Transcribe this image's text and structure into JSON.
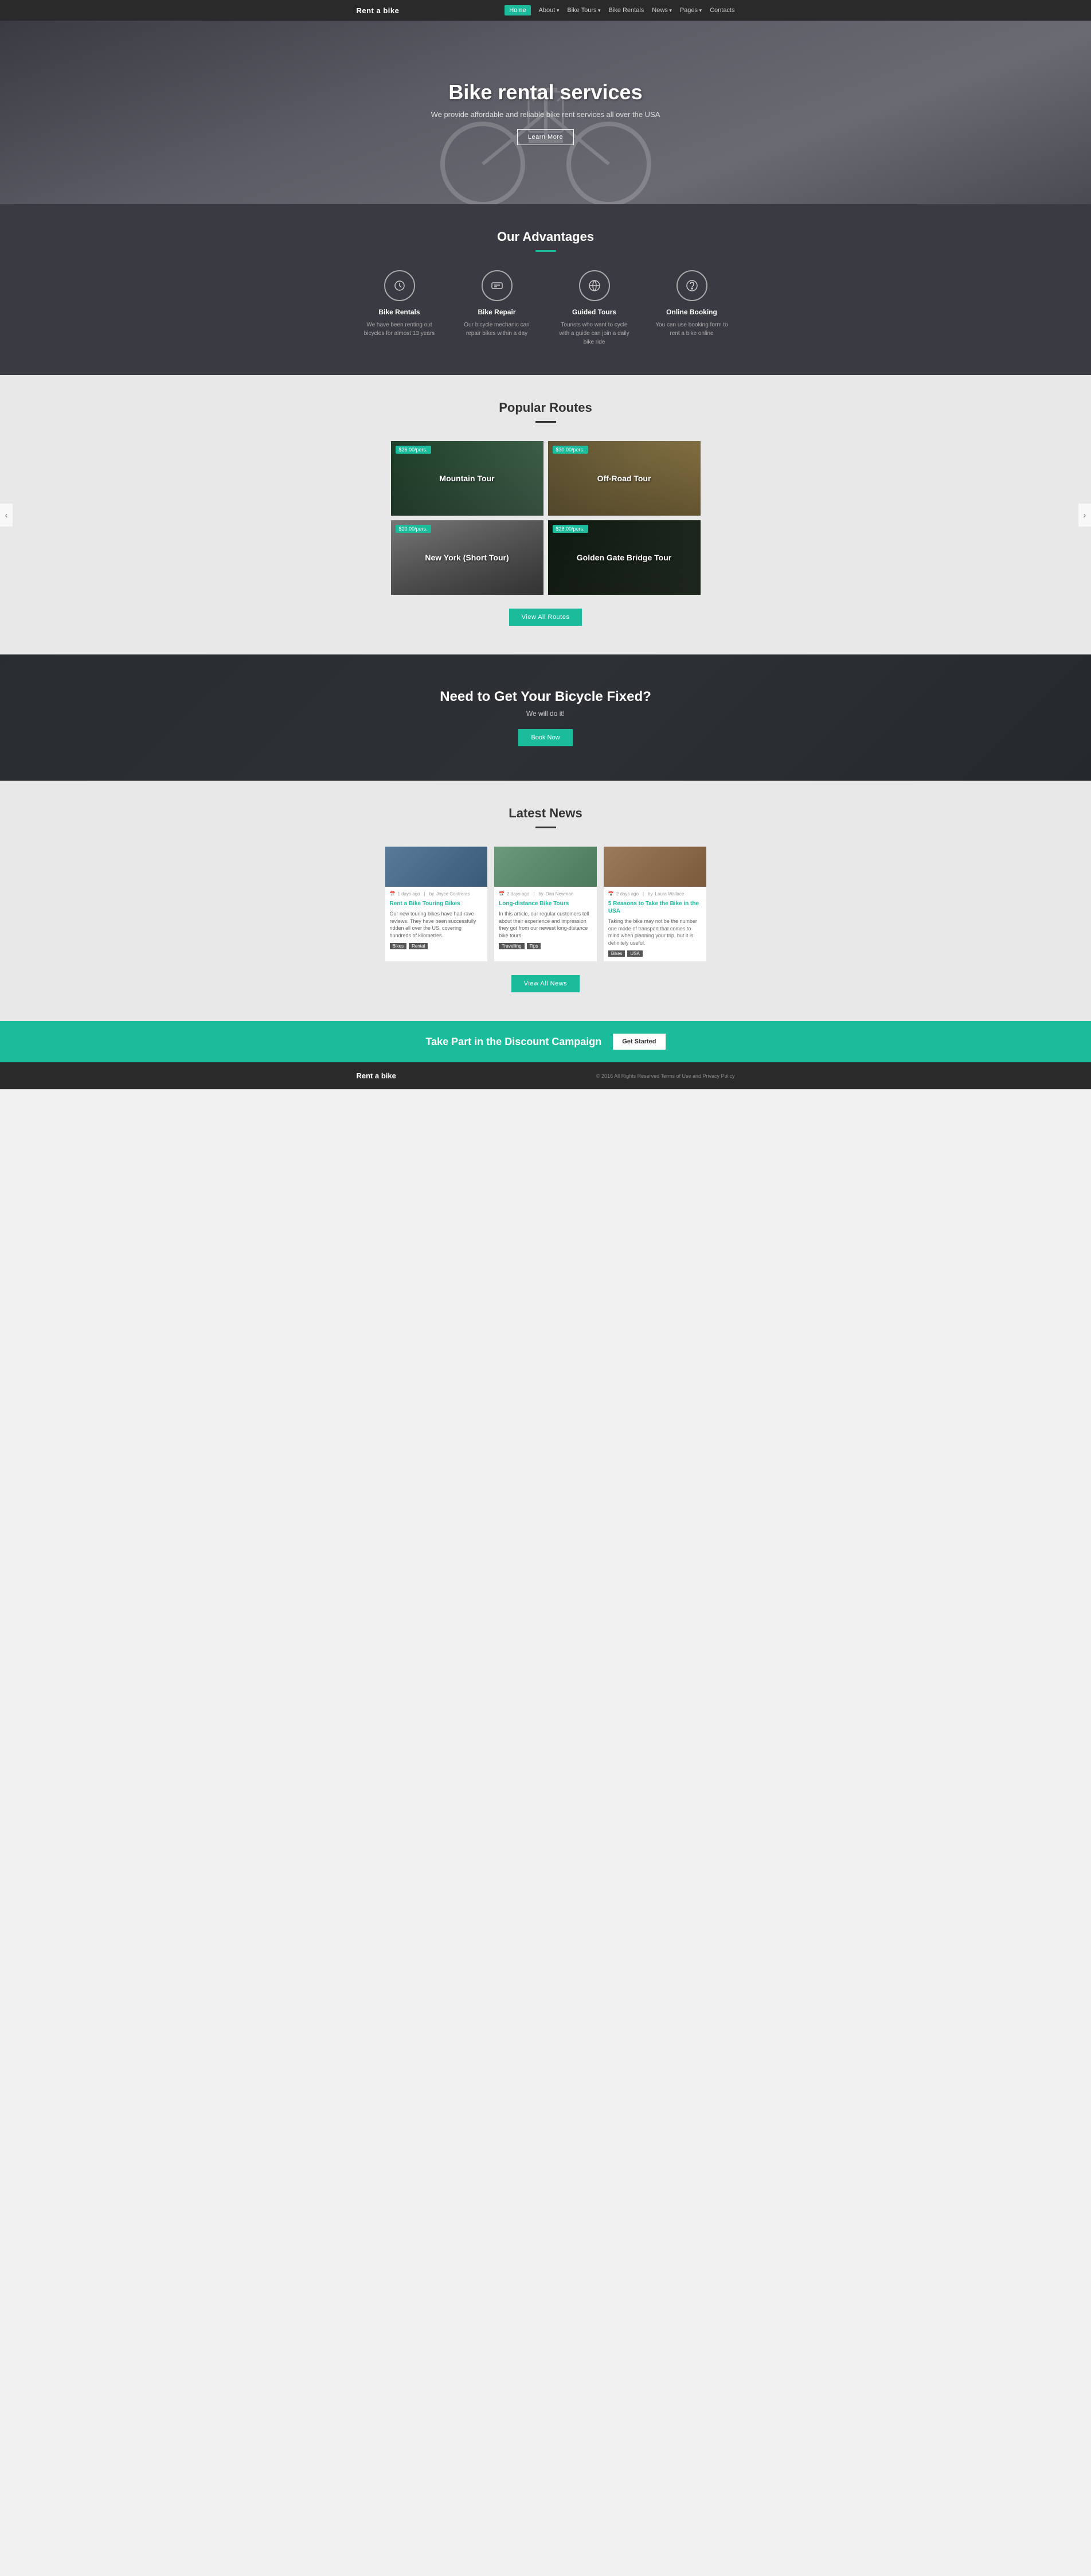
{
  "nav": {
    "logo": "Rent a bike",
    "links": [
      {
        "label": "Home",
        "active": true,
        "has_arrow": false
      },
      {
        "label": "About",
        "active": false,
        "has_arrow": true
      },
      {
        "label": "Bike Tours",
        "active": false,
        "has_arrow": true
      },
      {
        "label": "Bike Rentals",
        "active": false,
        "has_arrow": false
      },
      {
        "label": "News",
        "active": false,
        "has_arrow": true
      },
      {
        "label": "Pages",
        "active": false,
        "has_arrow": true
      },
      {
        "label": "Contacts",
        "active": false,
        "has_arrow": false
      }
    ]
  },
  "hero": {
    "title": "Bike rental services",
    "subtitle": "We provide affordable and reliable bike rent services all over the USA",
    "button": "Learn More"
  },
  "advantages": {
    "section_title": "Our Advantages",
    "items": [
      {
        "id": "bike-rentals",
        "icon": "🕐",
        "title": "Bike Rentals",
        "desc": "We have been renting out bicycles for almost 13 years"
      },
      {
        "id": "bike-repair",
        "icon": "💳",
        "title": "Bike Repair",
        "desc": "Our bicycle mechanic can repair bikes within a day"
      },
      {
        "id": "guided-tours",
        "icon": "🌐",
        "title": "Guided Tours",
        "desc": "Tourists who want to cycle with a guide can join a daily bike ride"
      },
      {
        "id": "online-booking",
        "icon": "😊",
        "title": "Online Booking",
        "desc": "You can use booking form to rent a bike online"
      }
    ]
  },
  "routes": {
    "section_title": "Popular Routes",
    "divider_color": "#333",
    "items": [
      {
        "id": "mountain",
        "name": "Mountain Tour",
        "price": "$26.00/pers.",
        "bg_class": "mountain"
      },
      {
        "id": "offroad",
        "name": "Off-Road Tour",
        "price": "$30.00/pers.",
        "bg_class": "offroad"
      },
      {
        "id": "newyork",
        "name": "New York (Short Tour)",
        "price": "$20.00/pers.",
        "bg_class": "newyork"
      },
      {
        "id": "goldengate",
        "name": "Golden Gate Bridge Tour",
        "price": "$28.00/pers.",
        "bg_class": "goldengate"
      }
    ],
    "view_all_btn": "View All Routes"
  },
  "repair_cta": {
    "title": "Need to Get Your Bicycle Fixed?",
    "subtitle": "We will do it!",
    "button": "Book Now"
  },
  "news": {
    "section_title": "Latest News",
    "view_all_btn": "View All News",
    "articles": [
      {
        "id": "touring-bikes",
        "days_ago": "1 days ago",
        "author": "Joyce Contreras",
        "title": "Rent a Bike Touring Bikes",
        "excerpt": "Our new touring bikes have had rave reviews. They have been successfully ridden all over the US, covering hundreds of kilometres.",
        "tags": [
          "Bikes",
          "Rental"
        ],
        "img_class": "cycling"
      },
      {
        "id": "long-distance",
        "days_ago": "2 days ago",
        "author": "Dan Newman",
        "title": "Long-distance Bike Tours",
        "excerpt": "In this article, our regular customers tell about their experience and impression they got from our newest long-distance bike tours.",
        "tags": [
          "Travelling",
          "Tips"
        ],
        "img_class": "helmet"
      },
      {
        "id": "5-reasons",
        "days_ago": "2 days ago",
        "author": "Laura Wallace",
        "title": "5 Reasons to Take the Bike in the USA",
        "excerpt": "Taking the bike may not be the number one mode of transport that comes to mind when planning your trip, but it is definitely useful.",
        "tags": [
          "Bikes",
          "USA"
        ],
        "img_class": "trail"
      }
    ]
  },
  "discount_banner": {
    "text": "Take Part in the Discount Campaign",
    "button": "Get Started"
  },
  "footer": {
    "logo": "Rent a bike",
    "copyright": "© 2016 All Rights Reserved Terms of Use and Privacy Policy"
  }
}
